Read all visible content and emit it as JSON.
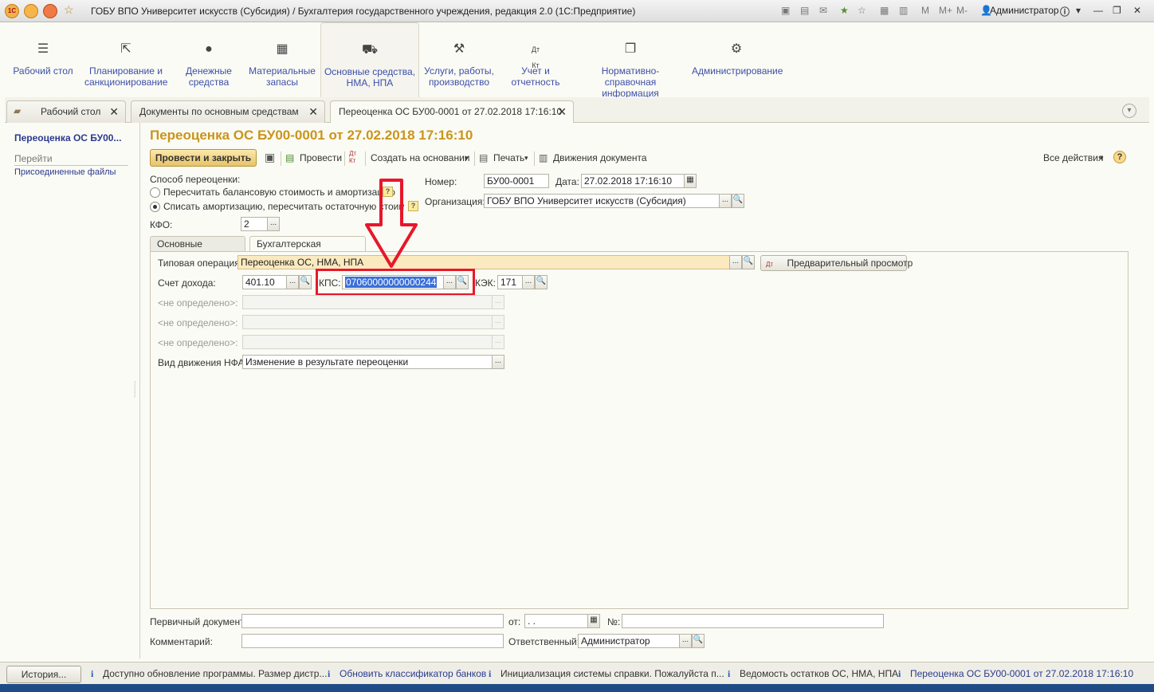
{
  "window": {
    "title": "ГОБУ ВПО Университет искусств (Субсидия) / Бухгалтерия государственного учреждения, редакция 2.0  (1С:Предприятие)",
    "user": "Администратор",
    "memory_buttons": [
      "M",
      "M+",
      "M-"
    ]
  },
  "sections": [
    {
      "label": "Рабочий стол",
      "icon": "menu-icon"
    },
    {
      "label": "Планирование и санкционирование",
      "icon": "planning-icon"
    },
    {
      "label": "Денежные средства",
      "icon": "money-icon"
    },
    {
      "label": "Материальные запасы",
      "icon": "grid-icon"
    },
    {
      "label": "Основные средства, НМА, НПА",
      "icon": "truck-icon"
    },
    {
      "label": "Услуги, работы, производство",
      "icon": "tools-icon"
    },
    {
      "label": "Учет и отчетность",
      "icon": "dt-kt-icon"
    },
    {
      "label": "Нормативно-справочная информация",
      "icon": "documents-icon"
    },
    {
      "label": "Администрирование",
      "icon": "gear-icon"
    }
  ],
  "tabs": [
    {
      "label": "Рабочий стол"
    },
    {
      "label": "Документы по основным средствам"
    },
    {
      "label": "Переоценка ОС БУ00-0001 от 27.02.2018 17:16:10"
    }
  ],
  "left": {
    "title": "Переоценка ОС БУ00...",
    "go": "Перейти",
    "attached": "Присоединенные файлы"
  },
  "form": {
    "title": "Переоценка ОС БУ00-0001 от 27.02.2018 17:16:10",
    "toolbar": {
      "post_close": "Провести и закрыть",
      "post": "Провести",
      "create_based": "Создать на основании",
      "print": "Печать",
      "movements": "Движения документа",
      "all_actions": "Все действия"
    },
    "revaluation_method_label": "Способ переоценки:",
    "method_options": [
      "Пересчитать балансовую стоимость и амортизацию",
      "Списать амортизацию, пересчитать остаточную стоимость"
    ],
    "number_label": "Номер:",
    "number": "БУ00-0001",
    "date_label": "Дата:",
    "date": "27.02.2018 17:16:10",
    "org_label": "Организация:",
    "org": "ГОБУ ВПО Университет искусств (Субсидия)",
    "kfo_label": "КФО:",
    "kfo": "2",
    "inner_tabs": [
      "Основные средства",
      "Бухгалтерская операция"
    ],
    "typical_op_label": "Типовая операция:",
    "typical_op": "Переоценка ОС, НМА, НПА",
    "preview": "Предварительный просмотр",
    "income_acc_label": "Счет дохода:",
    "income_acc": "401.10",
    "kps_label": "КПС:",
    "kps": "07060000000000244",
    "kek_label": "КЭК:",
    "kek": "171",
    "undef_label": "<не определено>:",
    "nfa_label": "Вид движения НФА:",
    "nfa": "Изменение в результате переоценки",
    "primary_doc_label": "Первичный документ:",
    "from_label": "от:",
    "from_value": " .  .",
    "no_label": "№:",
    "comment_label": "Комментарий:",
    "responsible_label": "Ответственный:",
    "responsible": "Администратор"
  },
  "status": {
    "history": "История...",
    "messages": [
      "Доступно обновление программы. Размер дистр...",
      "Обновить классификатор банков",
      "Инициализация системы справки. Пожалуйста п...",
      "Ведомость остатков ОС, НМА, НПА",
      "Переоценка ОС БУ00-0001 от 27.02.2018 17:16:10"
    ]
  },
  "colors": {
    "accent": "#c9951b",
    "highlight": "#e8172a",
    "link": "#2a3a8f"
  }
}
